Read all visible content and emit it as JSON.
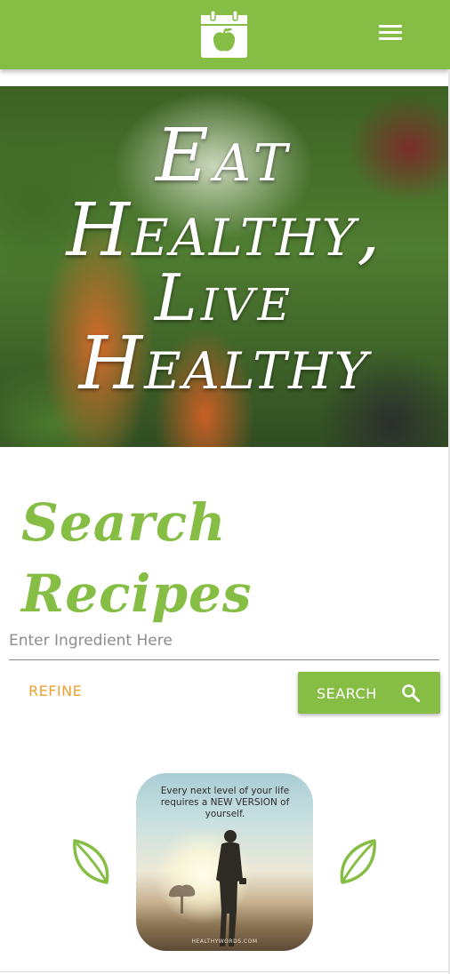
{
  "header": {
    "logo": "apple-calendar-logo",
    "menu_icon": "hamburger-menu-icon",
    "brand_color": "#86bd45"
  },
  "hero": {
    "lines": [
      "Eat",
      "Healthy,",
      "Live",
      "Healthy"
    ]
  },
  "search": {
    "title": "Search Recipes",
    "input_placeholder": "Enter Ingredient Here",
    "input_value": "",
    "refine_label": "REFINE",
    "search_label": "SEARCH",
    "search_icon": "magnifier-icon",
    "accent_color": "#f0a030"
  },
  "quote": {
    "text": "Every next level of your life requires a NEW VERSION of yourself.",
    "credit": "HEALTHYWORDS.COM",
    "decor_icons": [
      "leaf-icon",
      "leaf-icon"
    ]
  }
}
